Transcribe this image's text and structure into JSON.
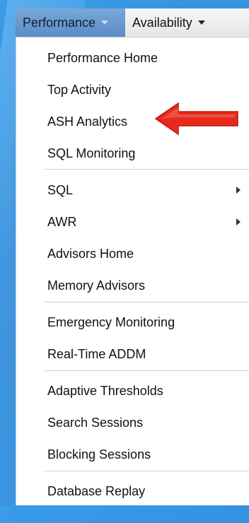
{
  "menubar": {
    "tabs": [
      {
        "label": "Performance",
        "icon": "chevron-down-icon"
      },
      {
        "label": "Availability",
        "icon": "chevron-down-icon"
      }
    ]
  },
  "dropdown": {
    "items": [
      {
        "label": "Performance Home"
      },
      {
        "label": "Top Activity"
      },
      {
        "label": "ASH Analytics"
      },
      {
        "label": "SQL Monitoring"
      },
      {
        "label": "SQL",
        "submenu": true
      },
      {
        "label": "AWR",
        "submenu": true
      },
      {
        "label": "Advisors Home"
      },
      {
        "label": "Memory Advisors"
      },
      {
        "label": "Emergency Monitoring"
      },
      {
        "label": "Real-Time ADDM"
      },
      {
        "label": "Adaptive Thresholds"
      },
      {
        "label": "Search Sessions"
      },
      {
        "label": "Blocking Sessions"
      },
      {
        "label": "Database Replay"
      }
    ]
  },
  "annotation": {
    "arrow_color": "#e8291b",
    "arrow_icon": "red-arrow-icon"
  }
}
